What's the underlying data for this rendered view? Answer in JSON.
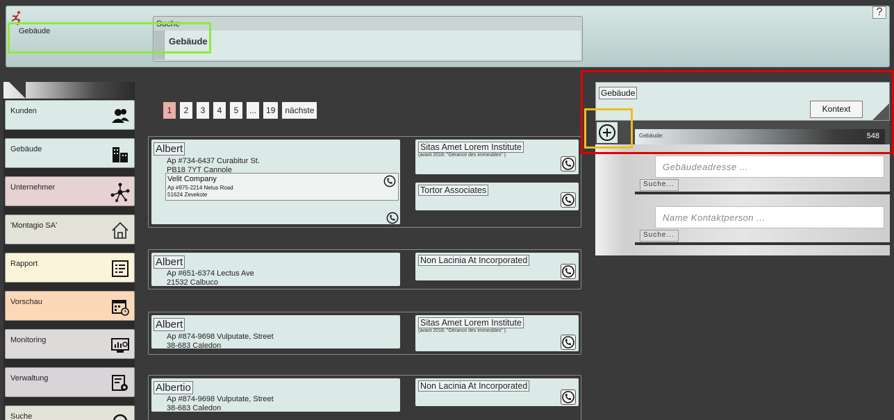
{
  "header": {
    "help_label": "?",
    "breadcrumb": "Gebäude",
    "search_label": "Suche",
    "search_value": "Gebäude"
  },
  "sidebar": {
    "items": [
      {
        "label": "Kunden",
        "icon": "users-icon",
        "bg": "#dbe9e7"
      },
      {
        "label": "Gebäude",
        "icon": "building-icon",
        "bg": "#dbe9e7"
      },
      {
        "label": "Unternehmer",
        "icon": "network-icon",
        "bg": "#e6d2d2"
      },
      {
        "label": "'Montagio SA'",
        "icon": "home-icon",
        "bg": "#e2e2d8"
      },
      {
        "label": "Rapport",
        "icon": "report-icon",
        "bg": "#fbf3da"
      },
      {
        "label": "Vorschau",
        "icon": "calendar-icon",
        "bg": "#fcd8b8"
      },
      {
        "label": "Monitoring",
        "icon": "monitor-icon",
        "bg": "#dedada"
      },
      {
        "label": "Verwaltung",
        "icon": "admin-icon",
        "bg": "#d8d4d8"
      },
      {
        "label": "Suche",
        "icon": "search-icon",
        "bg": "#e2e2d8"
      }
    ]
  },
  "pager": {
    "pages": [
      "1",
      "2",
      "3",
      "4",
      "5",
      "...",
      "19"
    ],
    "active": "1",
    "next_label": "nächste"
  },
  "results": [
    {
      "name": "Albert",
      "address": [
        "Ap #734-6437 Curabitur St.",
        "PB18 7YT Cannole"
      ],
      "sub_company": {
        "name": "Velit Company",
        "line1": "Ap #975-2214 Netus Road",
        "line2": "51624 Zevekote"
      },
      "companies": [
        {
          "name": "Sitas Amet Lorem Institute",
          "note": "(avant 2016: \"Gérance des immeubles\" )"
        },
        {
          "name": "Tortor Associates",
          "note": ""
        }
      ]
    },
    {
      "name": "Albert",
      "address": [
        "Ap #651-6374 Lectus Ave",
        "21532 Calbuco"
      ],
      "companies": [
        {
          "name": "Non Lacinia At Incorporated",
          "note": ""
        }
      ]
    },
    {
      "name": "Albert",
      "address": [
        "Ap #874-9698 Vulputate, Street",
        "38-683 Caledon"
      ],
      "companies": [
        {
          "name": "Sitas Amet Lorem Institute",
          "note": "(avant 2016: \"Gérance des immeubles\" )"
        }
      ]
    },
    {
      "name": "Albertio",
      "address": [
        "Ap #874-9698 Vulputate, Street",
        "38-683 Caledon"
      ],
      "companies": [
        {
          "name": "Non Lacinia At Incorporated",
          "note": ""
        }
      ]
    }
  ],
  "panel": {
    "title": "Gebäude",
    "context_button": "Kontext",
    "count_label": "Gebäude:",
    "count_value": "548",
    "address_placeholder": "Gebäudeadresse ...",
    "contact_placeholder": "Name Kontaktperson ...",
    "search_button": "Suche..."
  }
}
